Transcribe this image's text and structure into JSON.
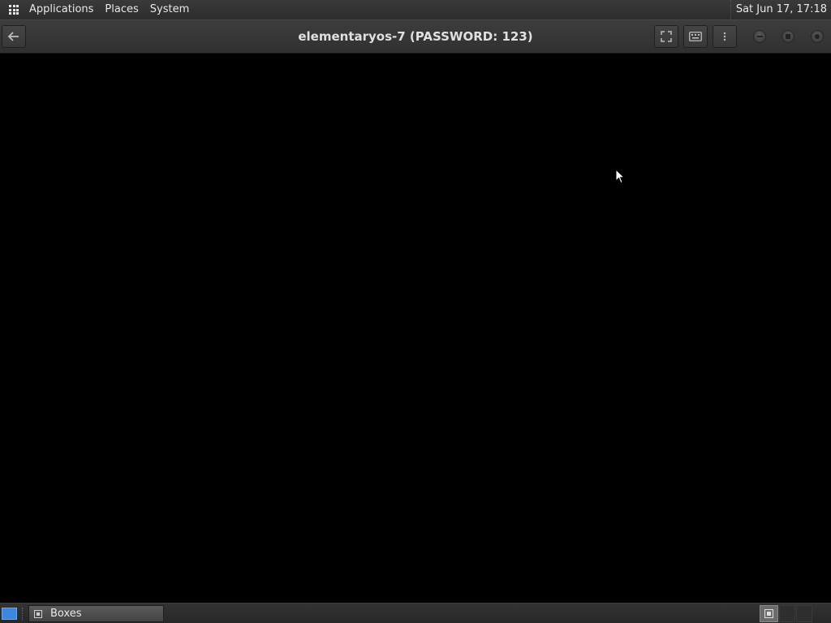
{
  "top_panel": {
    "menus": [
      "Applications",
      "Places",
      "System"
    ],
    "clock": "Sat Jun 17, 17:18"
  },
  "headerbar": {
    "title": "elementaryos-7 (PASSWORD: 123)",
    "back_icon": "arrow-left-icon",
    "fullscreen_icon": "fullscreen-icon",
    "keyboard_icon": "keyboard-icon",
    "menu_icon": "kebab-menu-icon"
  },
  "taskbar": {
    "windows": [
      {
        "label": "Boxes",
        "icon": "boxes-icon"
      }
    ],
    "workspaces": 3
  },
  "colors": {
    "panel_bg": "#2c2c2c",
    "headerbar_bg": "#353535",
    "vm_display_bg": "#000000",
    "show_desktop_accent": "#3d86e0"
  }
}
